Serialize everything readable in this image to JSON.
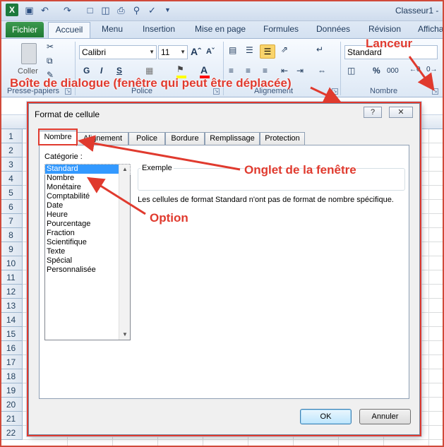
{
  "window": {
    "title": "Classeur1 -"
  },
  "ribbon_tabs": [
    {
      "label": "Fichier"
    },
    {
      "label": "Accueil"
    },
    {
      "label": "Menu"
    },
    {
      "label": "Insertion"
    },
    {
      "label": "Mise en page"
    },
    {
      "label": "Formules"
    },
    {
      "label": "Données"
    },
    {
      "label": "Révision"
    },
    {
      "label": "Affichage"
    }
  ],
  "ribbon": {
    "clipboard": {
      "paste_label": "Coller",
      "group_label": "Presse-papiers"
    },
    "font": {
      "name": "Calibri",
      "size": "11",
      "group_label": "Police",
      "bold": "G",
      "italic": "I",
      "underline": "S"
    },
    "alignment": {
      "group_label": "Alignement"
    },
    "number": {
      "format": "Standard",
      "group_label": "Nombre",
      "percent": "%",
      "thousands": "000"
    }
  },
  "row_numbers": [
    "1",
    "2",
    "3",
    "4",
    "5",
    "6",
    "7",
    "8",
    "9",
    "10",
    "11",
    "12",
    "13",
    "14",
    "15",
    "16",
    "17",
    "18",
    "19",
    "20",
    "21",
    "22"
  ],
  "dialog": {
    "title": "Format de cellule",
    "help": "?",
    "close": "✕",
    "tabs": [
      "Nombre",
      "Alignement",
      "Police",
      "Bordure",
      "Remplissage",
      "Protection"
    ],
    "category_label": "Catégorie :",
    "categories": [
      "Standard",
      "Nombre",
      "Monétaire",
      "Comptabilité",
      "Date",
      "Heure",
      "Pourcentage",
      "Fraction",
      "Scientifique",
      "Texte",
      "Spécial",
      "Personnalisée"
    ],
    "selected_category": "Standard",
    "example_label": "Exemple",
    "description": "Les cellules de format Standard n'ont pas de format de nombre spécifique.",
    "ok_label": "OK",
    "cancel_label": "Annuler"
  },
  "annotations": {
    "launcher": "Lanceur",
    "dialog_box": "Boîte de dialogue (fenêtre qui peut être déplacée)",
    "window_tab": "Onglet de la fenêtre",
    "option": "Option",
    "color": "#e03a2e"
  }
}
